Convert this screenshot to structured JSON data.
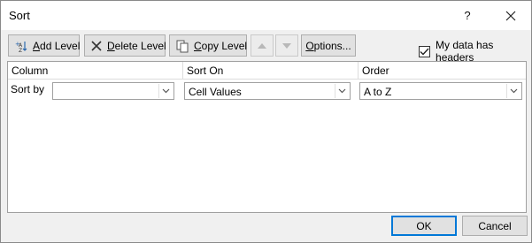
{
  "window": {
    "title": "Sort",
    "help_label": "?",
    "close_label": "✕"
  },
  "toolbar": {
    "add_level": {
      "prefix": "",
      "accel": "A",
      "rest": "dd Level"
    },
    "delete_level": {
      "accel": "D",
      "rest": "elete Level"
    },
    "copy_level": {
      "accel": "C",
      "rest": "opy Level"
    },
    "options": {
      "accel": "O",
      "rest": "ptions..."
    }
  },
  "headers_option": {
    "pre": "My data has ",
    "accel": "h",
    "rest": "eaders",
    "checked": true
  },
  "grid": {
    "columns": [
      "Column",
      "Sort On",
      "Order"
    ],
    "rows": [
      {
        "label": "Sort by",
        "column": "",
        "sort_on": "Cell Values",
        "order": "A to Z"
      }
    ]
  },
  "buttons": {
    "ok": "OK",
    "cancel": "Cancel"
  },
  "colors": {
    "dialog_bg": "#f0f0f0",
    "button_bg": "#e1e1e1",
    "default_border": "#0078d7"
  }
}
